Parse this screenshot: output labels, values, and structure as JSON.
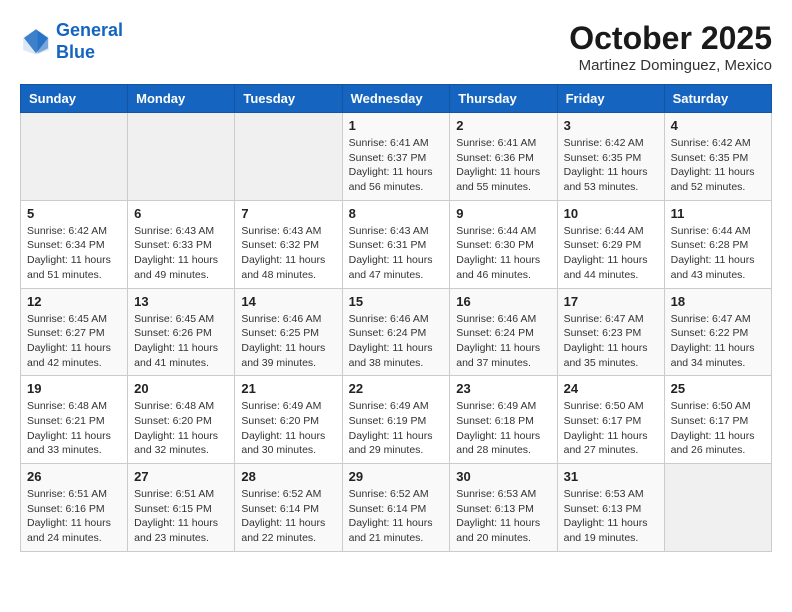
{
  "header": {
    "logo_line1": "General",
    "logo_line2": "Blue",
    "month": "October 2025",
    "location": "Martinez Dominguez, Mexico"
  },
  "days_of_week": [
    "Sunday",
    "Monday",
    "Tuesday",
    "Wednesday",
    "Thursday",
    "Friday",
    "Saturday"
  ],
  "weeks": [
    [
      {
        "num": "",
        "sunrise": "",
        "sunset": "",
        "daylight": "",
        "empty": true
      },
      {
        "num": "",
        "sunrise": "",
        "sunset": "",
        "daylight": "",
        "empty": true
      },
      {
        "num": "",
        "sunrise": "",
        "sunset": "",
        "daylight": "",
        "empty": true
      },
      {
        "num": "1",
        "sunrise": "Sunrise: 6:41 AM",
        "sunset": "Sunset: 6:37 PM",
        "daylight": "Daylight: 11 hours and 56 minutes."
      },
      {
        "num": "2",
        "sunrise": "Sunrise: 6:41 AM",
        "sunset": "Sunset: 6:36 PM",
        "daylight": "Daylight: 11 hours and 55 minutes."
      },
      {
        "num": "3",
        "sunrise": "Sunrise: 6:42 AM",
        "sunset": "Sunset: 6:35 PM",
        "daylight": "Daylight: 11 hours and 53 minutes."
      },
      {
        "num": "4",
        "sunrise": "Sunrise: 6:42 AM",
        "sunset": "Sunset: 6:35 PM",
        "daylight": "Daylight: 11 hours and 52 minutes."
      }
    ],
    [
      {
        "num": "5",
        "sunrise": "Sunrise: 6:42 AM",
        "sunset": "Sunset: 6:34 PM",
        "daylight": "Daylight: 11 hours and 51 minutes."
      },
      {
        "num": "6",
        "sunrise": "Sunrise: 6:43 AM",
        "sunset": "Sunset: 6:33 PM",
        "daylight": "Daylight: 11 hours and 49 minutes."
      },
      {
        "num": "7",
        "sunrise": "Sunrise: 6:43 AM",
        "sunset": "Sunset: 6:32 PM",
        "daylight": "Daylight: 11 hours and 48 minutes."
      },
      {
        "num": "8",
        "sunrise": "Sunrise: 6:43 AM",
        "sunset": "Sunset: 6:31 PM",
        "daylight": "Daylight: 11 hours and 47 minutes."
      },
      {
        "num": "9",
        "sunrise": "Sunrise: 6:44 AM",
        "sunset": "Sunset: 6:30 PM",
        "daylight": "Daylight: 11 hours and 46 minutes."
      },
      {
        "num": "10",
        "sunrise": "Sunrise: 6:44 AM",
        "sunset": "Sunset: 6:29 PM",
        "daylight": "Daylight: 11 hours and 44 minutes."
      },
      {
        "num": "11",
        "sunrise": "Sunrise: 6:44 AM",
        "sunset": "Sunset: 6:28 PM",
        "daylight": "Daylight: 11 hours and 43 minutes."
      }
    ],
    [
      {
        "num": "12",
        "sunrise": "Sunrise: 6:45 AM",
        "sunset": "Sunset: 6:27 PM",
        "daylight": "Daylight: 11 hours and 42 minutes."
      },
      {
        "num": "13",
        "sunrise": "Sunrise: 6:45 AM",
        "sunset": "Sunset: 6:26 PM",
        "daylight": "Daylight: 11 hours and 41 minutes."
      },
      {
        "num": "14",
        "sunrise": "Sunrise: 6:46 AM",
        "sunset": "Sunset: 6:25 PM",
        "daylight": "Daylight: 11 hours and 39 minutes."
      },
      {
        "num": "15",
        "sunrise": "Sunrise: 6:46 AM",
        "sunset": "Sunset: 6:24 PM",
        "daylight": "Daylight: 11 hours and 38 minutes."
      },
      {
        "num": "16",
        "sunrise": "Sunrise: 6:46 AM",
        "sunset": "Sunset: 6:24 PM",
        "daylight": "Daylight: 11 hours and 37 minutes."
      },
      {
        "num": "17",
        "sunrise": "Sunrise: 6:47 AM",
        "sunset": "Sunset: 6:23 PM",
        "daylight": "Daylight: 11 hours and 35 minutes."
      },
      {
        "num": "18",
        "sunrise": "Sunrise: 6:47 AM",
        "sunset": "Sunset: 6:22 PM",
        "daylight": "Daylight: 11 hours and 34 minutes."
      }
    ],
    [
      {
        "num": "19",
        "sunrise": "Sunrise: 6:48 AM",
        "sunset": "Sunset: 6:21 PM",
        "daylight": "Daylight: 11 hours and 33 minutes."
      },
      {
        "num": "20",
        "sunrise": "Sunrise: 6:48 AM",
        "sunset": "Sunset: 6:20 PM",
        "daylight": "Daylight: 11 hours and 32 minutes."
      },
      {
        "num": "21",
        "sunrise": "Sunrise: 6:49 AM",
        "sunset": "Sunset: 6:20 PM",
        "daylight": "Daylight: 11 hours and 30 minutes."
      },
      {
        "num": "22",
        "sunrise": "Sunrise: 6:49 AM",
        "sunset": "Sunset: 6:19 PM",
        "daylight": "Daylight: 11 hours and 29 minutes."
      },
      {
        "num": "23",
        "sunrise": "Sunrise: 6:49 AM",
        "sunset": "Sunset: 6:18 PM",
        "daylight": "Daylight: 11 hours and 28 minutes."
      },
      {
        "num": "24",
        "sunrise": "Sunrise: 6:50 AM",
        "sunset": "Sunset: 6:17 PM",
        "daylight": "Daylight: 11 hours and 27 minutes."
      },
      {
        "num": "25",
        "sunrise": "Sunrise: 6:50 AM",
        "sunset": "Sunset: 6:17 PM",
        "daylight": "Daylight: 11 hours and 26 minutes."
      }
    ],
    [
      {
        "num": "26",
        "sunrise": "Sunrise: 6:51 AM",
        "sunset": "Sunset: 6:16 PM",
        "daylight": "Daylight: 11 hours and 24 minutes."
      },
      {
        "num": "27",
        "sunrise": "Sunrise: 6:51 AM",
        "sunset": "Sunset: 6:15 PM",
        "daylight": "Daylight: 11 hours and 23 minutes."
      },
      {
        "num": "28",
        "sunrise": "Sunrise: 6:52 AM",
        "sunset": "Sunset: 6:14 PM",
        "daylight": "Daylight: 11 hours and 22 minutes."
      },
      {
        "num": "29",
        "sunrise": "Sunrise: 6:52 AM",
        "sunset": "Sunset: 6:14 PM",
        "daylight": "Daylight: 11 hours and 21 minutes."
      },
      {
        "num": "30",
        "sunrise": "Sunrise: 6:53 AM",
        "sunset": "Sunset: 6:13 PM",
        "daylight": "Daylight: 11 hours and 20 minutes."
      },
      {
        "num": "31",
        "sunrise": "Sunrise: 6:53 AM",
        "sunset": "Sunset: 6:13 PM",
        "daylight": "Daylight: 11 hours and 19 minutes."
      },
      {
        "num": "",
        "sunrise": "",
        "sunset": "",
        "daylight": "",
        "empty": true
      }
    ]
  ]
}
